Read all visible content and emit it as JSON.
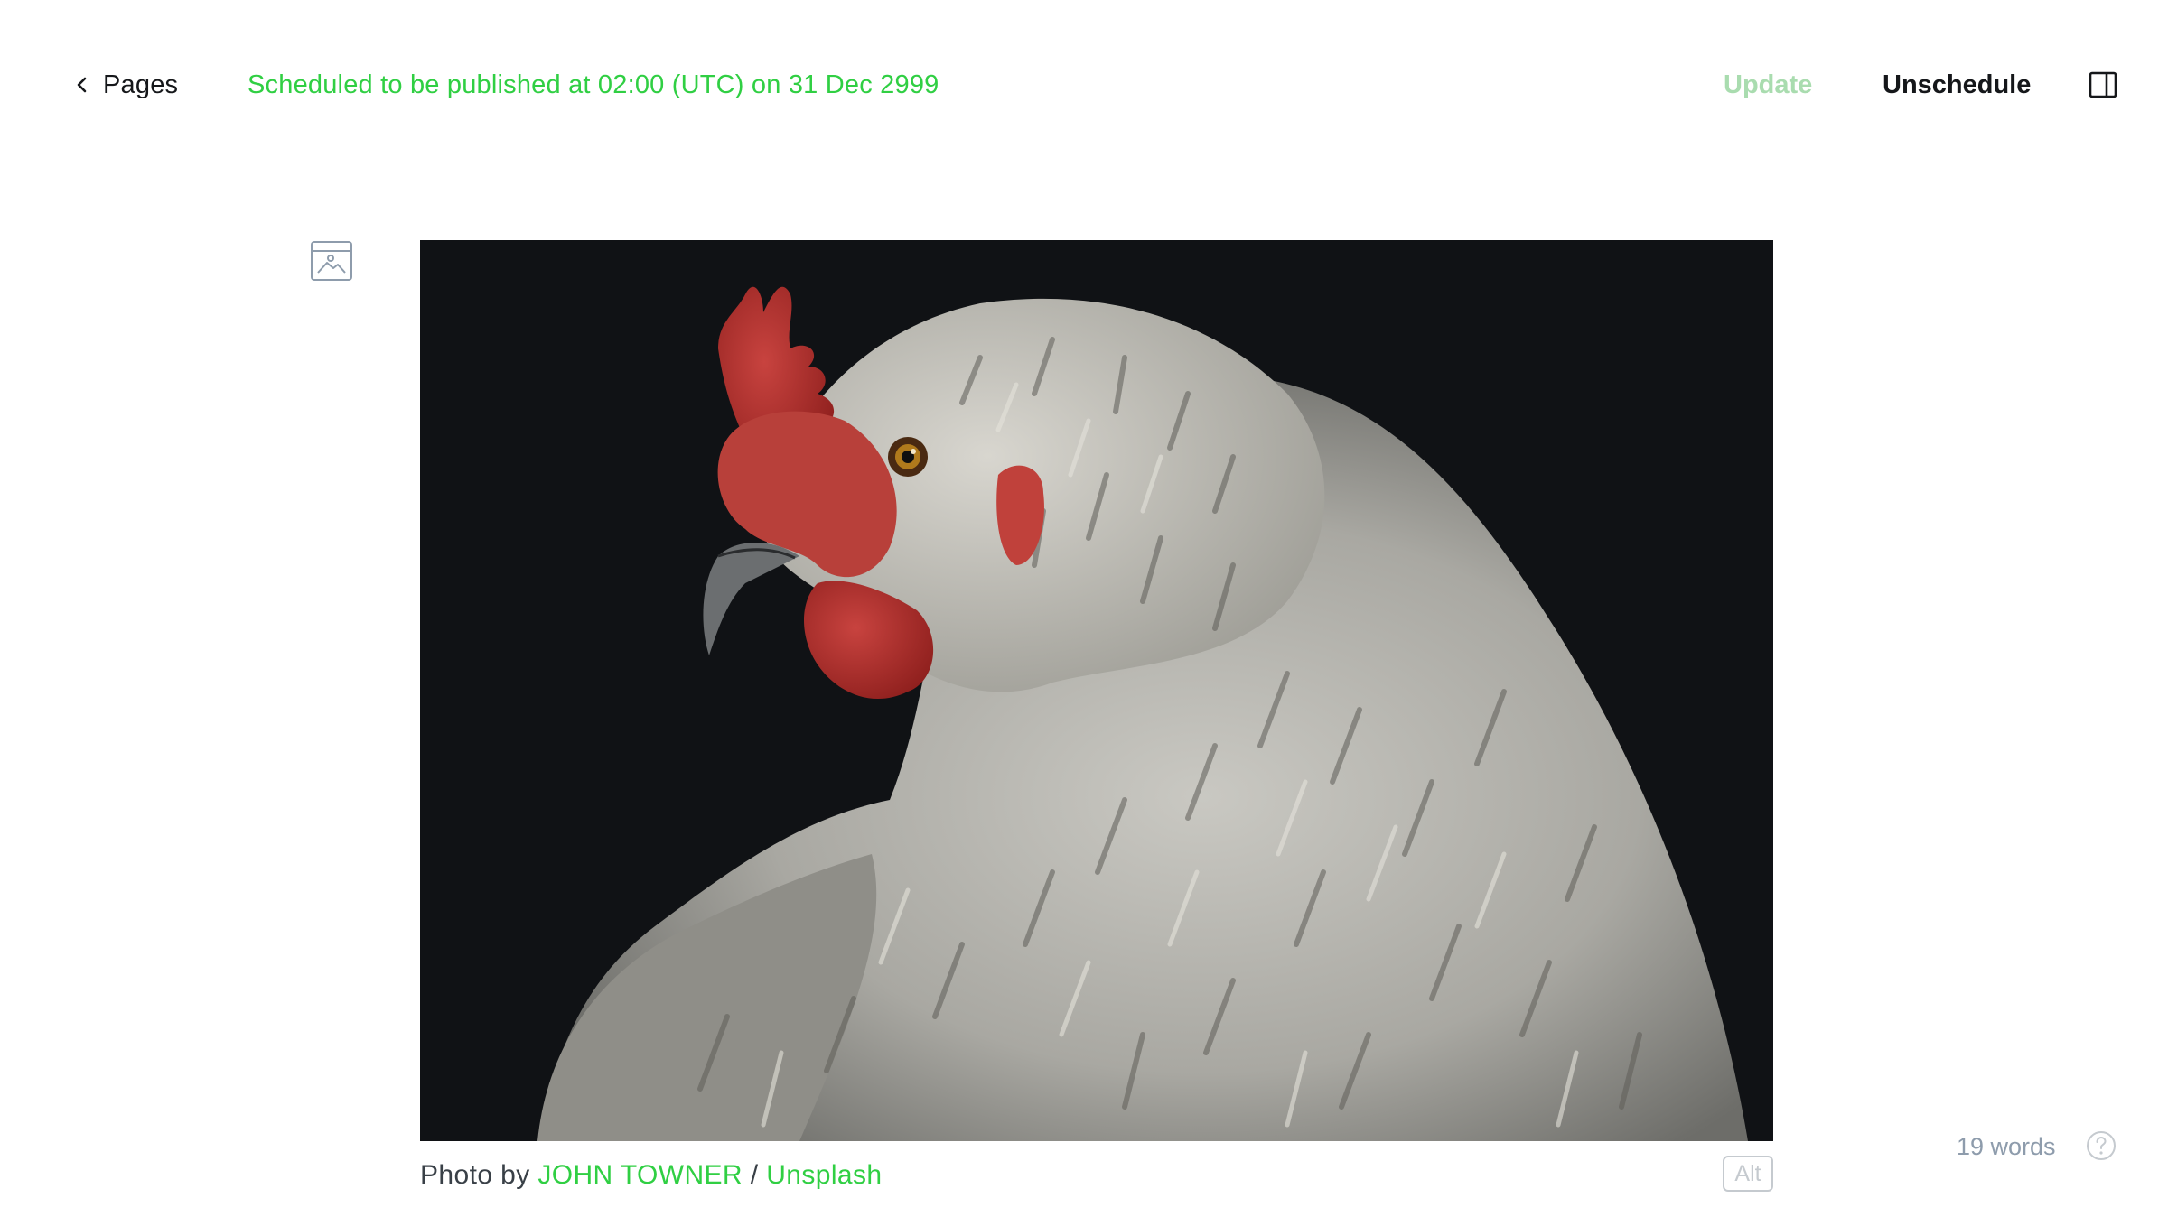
{
  "header": {
    "back_label": "Pages",
    "status_text": "Scheduled to be published at 02:00 (UTC) on 31 Dec 2999",
    "update_label": "Update",
    "unschedule_label": "Unschedule"
  },
  "feature_image": {
    "caption_prefix": "Photo by ",
    "author": "JOHN TOWNER",
    "separator": " / ",
    "source": "Unsplash",
    "alt_label": "Alt"
  },
  "footer": {
    "word_count": "19 words"
  },
  "icons": {
    "back": "chevron-left-icon",
    "sidebar": "sidebar-toggle-icon",
    "card": "image-card-icon",
    "help": "help-circle-icon"
  },
  "colors": {
    "accent": "#30cf43",
    "accent_faded": "#a9dcaf",
    "text": "#15171a",
    "muted": "#8e9cac"
  }
}
